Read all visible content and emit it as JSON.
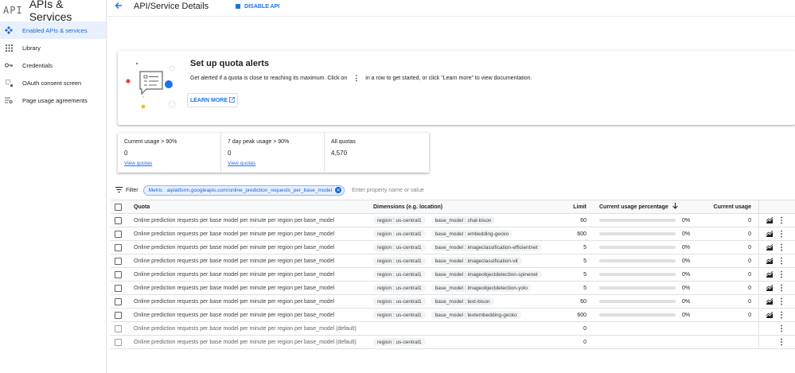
{
  "app": {
    "logo": "API",
    "title": "APIs & Services"
  },
  "sidebar": {
    "items": [
      {
        "label": "Enabled APIs & services",
        "icon": "enabled-apis-icon",
        "active": true
      },
      {
        "label": "Library",
        "icon": "library-icon",
        "active": false
      },
      {
        "label": "Credentials",
        "icon": "key-icon",
        "active": false
      },
      {
        "label": "OAuth consent screen",
        "icon": "consent-icon",
        "active": false
      },
      {
        "label": "Page usage agreements",
        "icon": "agreements-icon",
        "active": false
      }
    ]
  },
  "header": {
    "back_icon": "arrow-back-icon",
    "title": "API/Service Details",
    "disable_label": "DISABLE API"
  },
  "alert": {
    "title": "Set up quota alerts",
    "text_before": "Get alerted if a quota is close to reaching its maximum. Click on",
    "text_after": "in a row to get started, or click \"Learn more\" to view documentation.",
    "learn_more": "LEARN MORE"
  },
  "stats": [
    {
      "label": "Current usage > 90%",
      "value": "0",
      "link": "View quotas"
    },
    {
      "label": "7 day peak usage > 90%",
      "value": "0",
      "link": "View quotas"
    },
    {
      "label": "All quotas",
      "value": "4,570",
      "link": ""
    }
  ],
  "filter": {
    "label": "Filter",
    "chip": "Metric : aiplatform.googleapis.com/online_prediction_requests_per_base_model",
    "placeholder": "Enter property name or value"
  },
  "table": {
    "headers": {
      "quota": "Quota",
      "dimensions": "Dimensions (e.g. location)",
      "limit": "Limit",
      "usage_pct": "Current usage percentage",
      "current": "Current usage"
    },
    "rows": [
      {
        "quota": "Online prediction requests per base model per minute per region per base_model",
        "region": "region : us-central1",
        "model": "base_model : chat-bison",
        "limit": "60",
        "pct": "0%",
        "current": "0"
      },
      {
        "quota": "Online prediction requests per base model per minute per region per base_model",
        "region": "region : us-central1",
        "model": "base_model : embedding-gecko",
        "limit": "600",
        "pct": "0%",
        "current": "0"
      },
      {
        "quota": "Online prediction requests per base model per minute per region per base_model",
        "region": "region : us-central1",
        "model": "base_model : imageclassification-efficientnet",
        "limit": "5",
        "pct": "0%",
        "current": "0"
      },
      {
        "quota": "Online prediction requests per base model per minute per region per base_model",
        "region": "region : us-central1",
        "model": "base_model : imageclassification-vit",
        "limit": "5",
        "pct": "0%",
        "current": "0"
      },
      {
        "quota": "Online prediction requests per base model per minute per region per base_model",
        "region": "region : us-central1",
        "model": "base_model : imageobjectdetection-spinenet",
        "limit": "5",
        "pct": "0%",
        "current": "0"
      },
      {
        "quota": "Online prediction requests per base model per minute per region per base_model",
        "region": "region : us-central1",
        "model": "base_model : imageobjectdetection-yolo",
        "limit": "5",
        "pct": "0%",
        "current": "0"
      },
      {
        "quota": "Online prediction requests per base model per minute per region per base_model",
        "region": "region : us-central1",
        "model": "base_model : text-bison",
        "limit": "60",
        "pct": "0%",
        "current": "0"
      },
      {
        "quota": "Online prediction requests per base model per minute per region per base_model",
        "region": "region : us-central1",
        "model": "base_model : textembedding-gecko",
        "limit": "600",
        "pct": "0%",
        "current": "0"
      }
    ],
    "default_rows": [
      {
        "quota": "Online prediction requests per base model per minute per region per base_model (default)",
        "limit": "0"
      },
      {
        "quota": "Online prediction requests per base model per minute per region per base_model (default)",
        "region": "region : us-central1",
        "limit": "0"
      }
    ]
  },
  "colors": {
    "accent": "#1a73e8",
    "active_bg": "#e8f0fe"
  }
}
